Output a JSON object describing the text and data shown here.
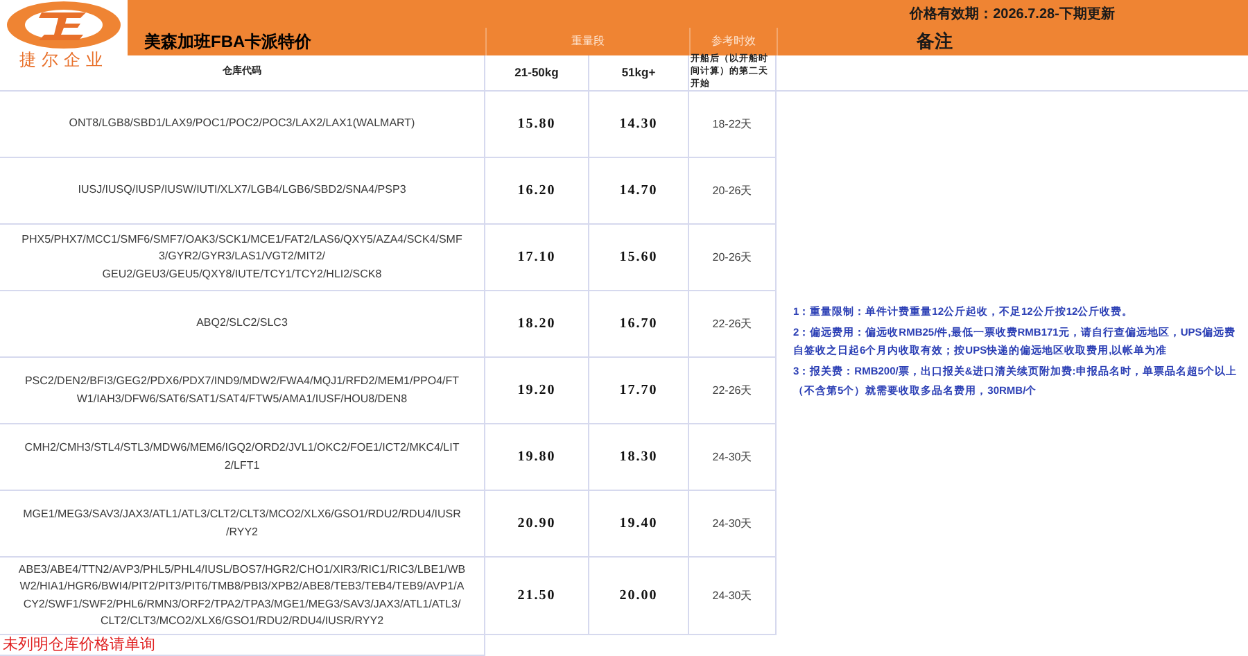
{
  "logo": {
    "text": "捷尔企业"
  },
  "validity": "价格有效期：2026.7.28-下期更新",
  "title": "美森加班FBA卡派特价",
  "header": {
    "weight_band": "重量段",
    "transit_ref": "参考时效",
    "remarks": "备注"
  },
  "columns": [
    "仓库代码",
    "21-50kg",
    "51kg+",
    "开船后（以开船时间计算）的第二天开始"
  ],
  "rows": [
    {
      "warehouses": [
        "ONT8/LGB8/SBD1/LAX9/POC1/POC2/POC3/LAX2/LAX1(WALMART)"
      ],
      "price_21_50": "15.80",
      "price_51_plus": "14.30",
      "transit": "18-22天"
    },
    {
      "warehouses": [
        "IUSJ/IUSQ/IUSP/IUSW/IUTI/XLX7/LGB4/LGB6/SBD2/SNA4/PSP3"
      ],
      "price_21_50": "16.20",
      "price_51_plus": "14.70",
      "transit": "20-26天"
    },
    {
      "warehouses": [
        "PHX5/PHX7/MCC1/SMF6/SMF7/OAK3/SCK1/MCE1/FAT2/LAS6/QXY5/AZA4/SCK4/SMF",
        "3/GYR2/GYR3/LAS1/VGT2/MIT2/",
        "GEU2/GEU3/GEU5/QXY8/IUTE/TCY1/TCY2/HLI2/SCK8"
      ],
      "price_21_50": "17.10",
      "price_51_plus": "15.60",
      "transit": "20-26天"
    },
    {
      "warehouses": [
        "ABQ2/SLC2/SLC3"
      ],
      "price_21_50": "18.20",
      "price_51_plus": "16.70",
      "transit": "22-26天"
    },
    {
      "warehouses": [
        "PSC2/DEN2/BFI3/GEG2/PDX6/PDX7/IND9/MDW2/FWA4/MQJ1/RFD2/MEM1/PPO4/FT",
        "W1/IAH3/DFW6/SAT6/SAT1/SAT4/FTW5/AMA1/IUSF/HOU8/DEN8"
      ],
      "price_21_50": "19.20",
      "price_51_plus": "17.70",
      "transit": "22-26天"
    },
    {
      "warehouses": [
        "CMH2/CMH3/STL4/STL3/MDW6/MEM6/IGQ2/ORD2/JVL1/OKC2/FOE1/ICT2/MKC4/LIT",
        "2/LFT1"
      ],
      "price_21_50": "19.80",
      "price_51_plus": "18.30",
      "transit": "24-30天"
    },
    {
      "warehouses": [
        "MGE1/MEG3/SAV3/JAX3/ATL1/ATL3/CLT2/CLT3/MCO2/XLX6/GSO1/RDU2/RDU4/IUSR",
        "/RYY2"
      ],
      "price_21_50": "20.90",
      "price_51_plus": "19.40",
      "transit": "24-30天"
    },
    {
      "warehouses": [
        "ABE3/ABE4/TTN2/AVP3/PHL5/PHL4/IUSL/BOS7/HGR2/CHO1/XIR3/RIC1/RIC3/LBE1/WB",
        "W2/HIA1/HGR6/BWI4/PIT2/PIT3/PIT6/TMB8/PBI3/XPB2/ABE8/TEB3/TEB4/TEB9/AVP1/A",
        "CY2/SWF1/SWF2/PHL6/RMN3/ORF2/TPA2/TPA3/MGE1/MEG3/SAV3/JAX3/ATL1/ATL3/",
        "CLT2/CLT3/MCO2/XLX6/GSO1/RDU2/RDU4/IUSR/RYY2"
      ],
      "price_21_50": "21.50",
      "price_51_plus": "20.00",
      "transit": "24-30天"
    }
  ],
  "notes": [
    "1：重量限制：单件计费重量12公斤起收，不足12公斤按12公斤收费。",
    "2：偏远费用：偏远收RMB25/件,最低一票收费RMB171元，请自行查偏远地区，UPS偏远费自签收之日起6个月内收取有效；按UPS快递的偏远地区收取费用,以帐单为准",
    "3：报关费：RMB200/票，出口报关&进口清关续页附加费:申报品名时，单票品名超5个以上（不含第5个）就需要收取多品名费用，30RMB/个"
  ],
  "footnote": "未列明仓库价格请单询"
}
